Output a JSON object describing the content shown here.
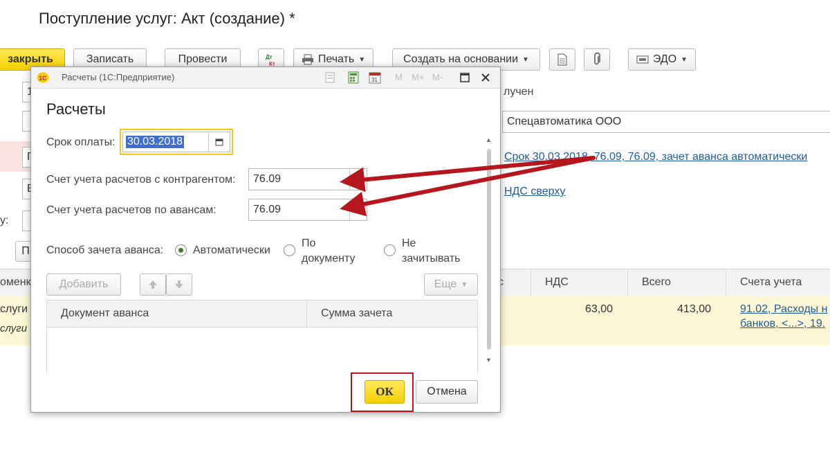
{
  "document": {
    "title": "Поступление услуг: Акт (создание) *"
  },
  "toolbar": {
    "close_label": "закрыть",
    "save_label": "Записать",
    "post_label": "Провести",
    "dtkt_label": "Дт Кт",
    "print_label": "Печать",
    "create_based_label": "Создать на основании",
    "edo_label": "ЭДО"
  },
  "background_form": {
    "received_label": "лучен",
    "counterparty_value": "Спецавтоматика ООО",
    "settlements_link": "Срок 30.03.2018, 76.09, 76.09, зачет аванса автоматически",
    "vat_link": "НДС сверху",
    "left_partial": {
      "f1": "1",
      "f2": "П",
      "f3": "В",
      "label_colon": "у:",
      "btn": "П"
    }
  },
  "table": {
    "columns": [
      "оменк",
      "с",
      "НДС",
      "Всего",
      "Счета учета"
    ],
    "rows": [
      {
        "name": "слуги",
        "vat": "63,00",
        "total": "413,00",
        "account_line1": "91.02, Расходы н",
        "account_line2": "банков, <...>, 19."
      },
      {
        "name": "слуги"
      }
    ]
  },
  "dialog": {
    "app_title": "Расчеты  (1С:Предприятие)",
    "title_icons": [
      "M",
      "M+",
      "M-"
    ],
    "heading": "Расчеты",
    "due_date_label": "Срок оплаты:",
    "due_date_value": "30.03.2018",
    "counterparty_account_label": "Счет учета расчетов с контрагентом:",
    "counterparty_account_value": "76.09",
    "advances_account_label": "Счет учета расчетов по авансам:",
    "advances_account_value": "76.09",
    "offset_method_label": "Способ зачета аванса:",
    "offset_options": [
      {
        "label": "Автоматически",
        "selected": true
      },
      {
        "label_line1": "По",
        "label_line2": "документу",
        "selected": false
      },
      {
        "label_line1": "Не",
        "label_line2": "зачитывать",
        "selected": false
      }
    ],
    "add_label": "Добавить",
    "more_label": "Еще",
    "table_columns": [
      "Документ аванса",
      "Сумма зачета"
    ],
    "ok_label": "ОК",
    "cancel_label": "Отмена"
  },
  "colors": {
    "accent_yellow": "#f5cf00",
    "highlight_row": "#fbf7d5",
    "link": "#1f5b99",
    "annotation_red": "#b5171c",
    "selection": "#3f6fd0"
  }
}
